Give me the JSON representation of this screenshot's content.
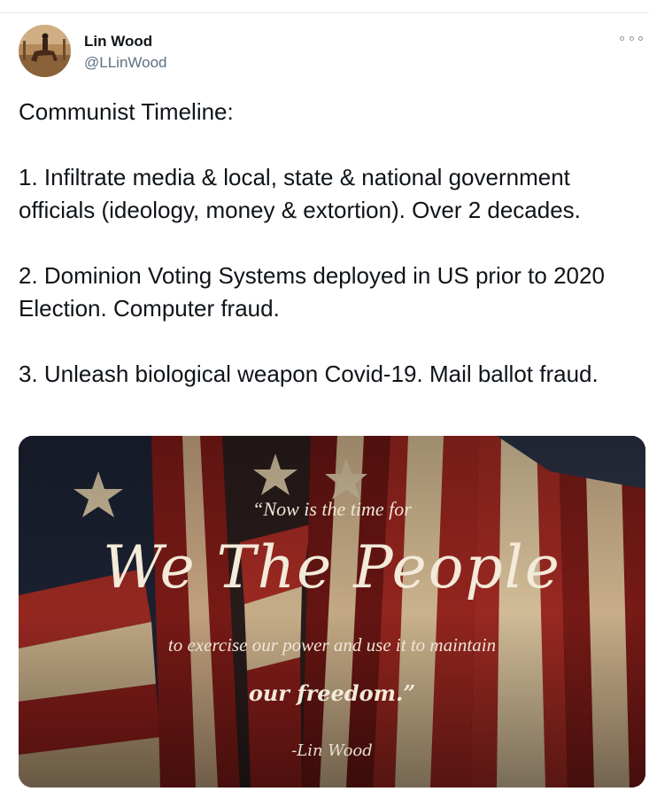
{
  "author": {
    "name": "Lin Wood",
    "handle": "@LLinWood",
    "avatar_icon": "avatar-horse-rider"
  },
  "more_icon": "more-options-icon",
  "tweet": {
    "paragraphs": [
      "Communist Timeline:",
      "1. Infiltrate media & local, state & national government officials (ideology, money & extortion). Over 2 decades.",
      "2. Dominion Voting Systems deployed in US prior to 2020 Election. Computer fraud.",
      "3. Unleash biological weapon Covid-19. Mail ballot fraud."
    ]
  },
  "media": {
    "line_top": "“Now is the time for",
    "line_big": "We The People",
    "line_mid": "to exercise our power and use it to maintain",
    "line_end": "our freedom.”",
    "signature": "-Lin Wood"
  },
  "colors": {
    "text": "#0f1419",
    "secondary": "#5b7083",
    "flag_red": "#8c1e1a",
    "flag_cream": "#d9c6a6",
    "flag_blue": "#1c2233"
  }
}
